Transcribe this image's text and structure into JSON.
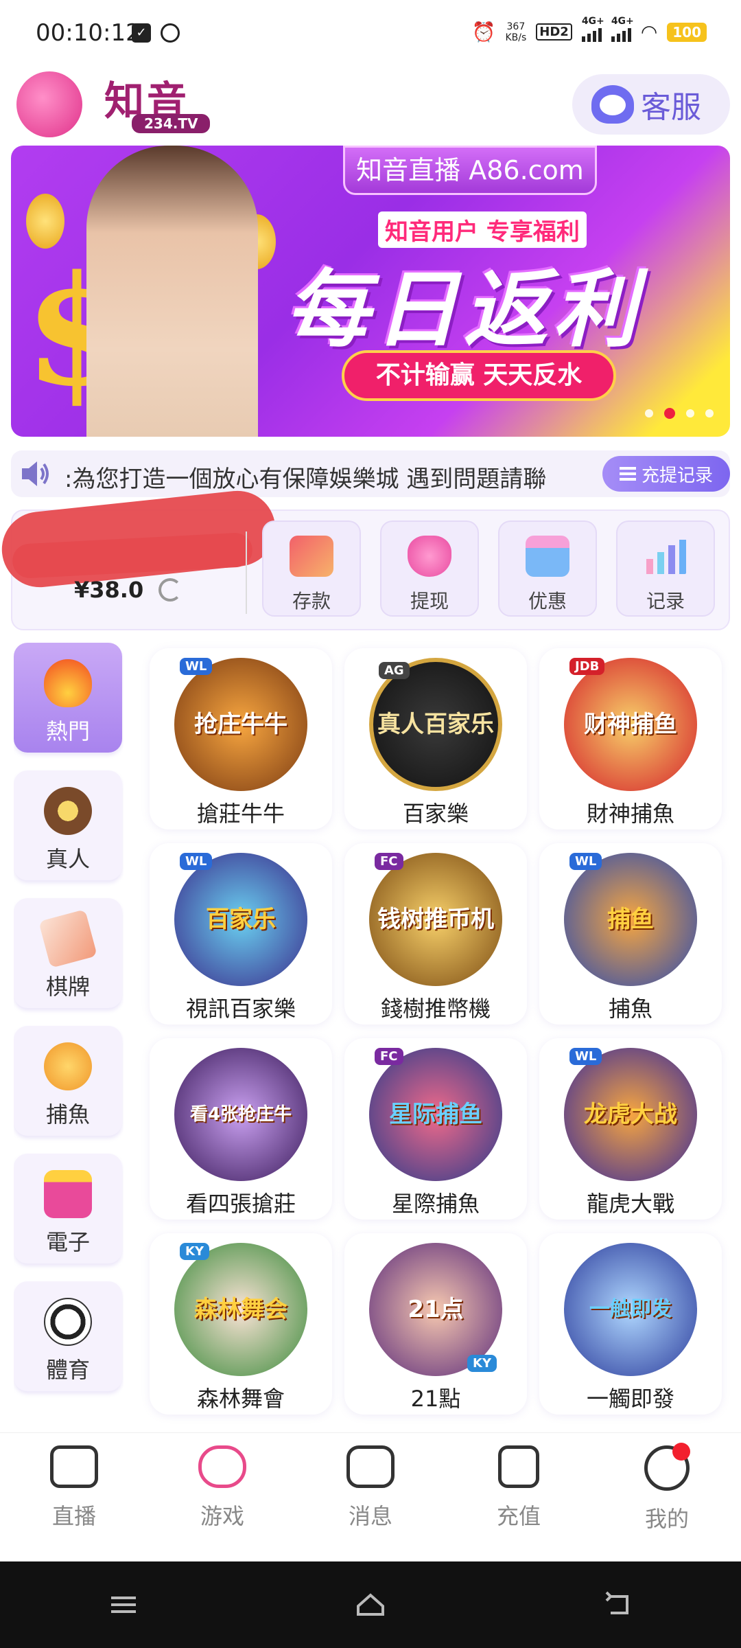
{
  "status_bar": {
    "time": "00:10:12",
    "speed_value": "367",
    "speed_unit": "KB/s",
    "hd": "HD2",
    "network_1": "4G+",
    "network_2": "4G+",
    "battery": "100"
  },
  "header": {
    "app_name": "知音",
    "app_domain": "234.TV",
    "customer_service_label": "客服"
  },
  "banner": {
    "site_label": "知音直播  A86.com",
    "subtitle": "知音用户 专享福利",
    "headline": "每日返利",
    "pill_text": "不计输赢 天天反水",
    "slides": 4,
    "active_slide": 2
  },
  "marquee": {
    "text": ":為您打造一個放心有保障娛樂城   遇到問題請聯",
    "record_button": "充提记录"
  },
  "wallet": {
    "balance": "¥38.0",
    "actions": [
      {
        "label": "存款",
        "icon": "card-icon",
        "color": "#f2606a"
      },
      {
        "label": "提现",
        "icon": "money-bag-icon",
        "color": "#f06ab4"
      },
      {
        "label": "优惠",
        "icon": "gift-icon",
        "color": "#7ab8f7"
      },
      {
        "label": "记录",
        "icon": "bar-chart-icon",
        "color": "#8c8cf0"
      }
    ]
  },
  "categories": [
    {
      "label": "熱門",
      "icon": "fire-icon",
      "active": true
    },
    {
      "label": "真人",
      "icon": "chip-icon",
      "active": false
    },
    {
      "label": "棋牌",
      "icon": "card-icon",
      "active": false
    },
    {
      "label": "捕魚",
      "icon": "fish-icon",
      "active": false
    },
    {
      "label": "電子",
      "icon": "slot-icon",
      "active": false
    },
    {
      "label": "體育",
      "icon": "football-icon",
      "active": false
    }
  ],
  "games": [
    {
      "label": "搶莊牛牛",
      "badge": "WL",
      "art": "抢庄牛牛"
    },
    {
      "label": "百家樂",
      "badge": "AG",
      "art": "真人百家乐"
    },
    {
      "label": "財神捕魚",
      "badge": "JDB",
      "art": "财神捕鱼"
    },
    {
      "label": "視訊百家樂",
      "badge": "WL",
      "art": "百家乐"
    },
    {
      "label": "錢樹推幣機",
      "badge": "FC",
      "art": "钱树推币机"
    },
    {
      "label": "捕魚",
      "badge": "WL",
      "art": "捕鱼"
    },
    {
      "label": "看四張搶莊",
      "badge": "",
      "art": "看4张抢庄牛"
    },
    {
      "label": "星際捕魚",
      "badge": "FC",
      "art": "星际捕鱼"
    },
    {
      "label": "龍虎大戰",
      "badge": "WL",
      "art": "龙虎大战"
    },
    {
      "label": "森林舞會",
      "badge": "KY",
      "art": "森林舞会"
    },
    {
      "label": "21點",
      "badge": "KY",
      "art": "21点"
    },
    {
      "label": "一觸即發",
      "badge": "",
      "art": "一触即发"
    }
  ],
  "bottom_nav": [
    {
      "label": "直播",
      "icon": "live-camera-icon"
    },
    {
      "label": "游戏",
      "icon": "gamepad-icon"
    },
    {
      "label": "消息",
      "icon": "message-icon"
    },
    {
      "label": "充值",
      "icon": "wallet-icon"
    },
    {
      "label": "我的",
      "icon": "profile-smile-icon",
      "notification": true
    }
  ],
  "colors": {
    "accent": "#7d66ef",
    "banner_purple": "#9a2ee6",
    "notification": "#f2202e"
  }
}
